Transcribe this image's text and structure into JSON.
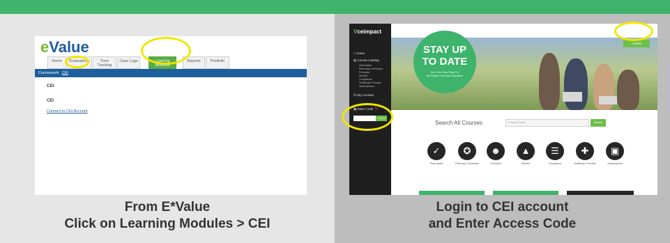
{
  "colors": {
    "brand_green": "#3db36b",
    "highlight_ring": "#f2e600",
    "evalue_blue": "#1c5f9c"
  },
  "left": {
    "evalue": {
      "logo_e": "e",
      "logo_rest": "Value",
      "tabs": [
        {
          "label": "Home"
        },
        {
          "label": "Evaluations"
        },
        {
          "label": "Time Tracking"
        },
        {
          "label": "Case Logs"
        },
        {
          "label": "Learning Modules",
          "active": true
        },
        {
          "label": "Reports"
        },
        {
          "label": "Portfolio"
        }
      ],
      "bar_label": "Coursework",
      "breadcrumb": "CEI",
      "heading": "CEI",
      "subheading": "CEI",
      "link": "Connect to CEI Account"
    },
    "caption_line1": "From E*Value",
    "caption_line2": "Click on Learning Modules > CEI"
  },
  "right": {
    "ceimpact": {
      "logo_v": "V",
      "logo_rest": "ceimpact",
      "nav": [
        {
          "label": "Home",
          "icon": "home-icon"
        },
        {
          "label": "Course Catalog",
          "icon": "catalog-icon"
        }
      ],
      "catalog_items": [
        "Pharmacist",
        "Pharmacy Technician",
        "Preceptor",
        "Student",
        "Compliance",
        "Healthcare Provider",
        "Subscriptions"
      ],
      "my_courses": "My Courses",
      "enter_code": "Enter Code",
      "submit_label": "Submit",
      "login_label": "LOGIN",
      "hero_big_1": "STAY UP",
      "hero_big_2": "TO DATE",
      "hero_small_1": "Your One Stop Shop For",
      "hero_small_2": "All Things Pharmacy Education",
      "search_label": "Search All Courses",
      "search_placeholder": "Course Finder",
      "search_button": "Search",
      "categories": [
        {
          "label": "Pharmacist",
          "icon": "checkmark-icon",
          "glyph": "✓"
        },
        {
          "label": "Pharmacy Technician",
          "icon": "award-icon",
          "glyph": "✪"
        },
        {
          "label": "Preceptor",
          "icon": "people-icon",
          "glyph": "☻"
        },
        {
          "label": "Student",
          "icon": "graduation-cap-icon",
          "glyph": "▲"
        },
        {
          "label": "Compliance",
          "icon": "document-check-icon",
          "glyph": "☰"
        },
        {
          "label": "Healthcare Provider",
          "icon": "provider-icon",
          "glyph": "✚"
        },
        {
          "label": "Subscriptions",
          "icon": "subscription-icon",
          "glyph": "▣"
        }
      ]
    },
    "caption_line1": "Login to CEI account",
    "caption_line2": "and Enter Access Code"
  }
}
